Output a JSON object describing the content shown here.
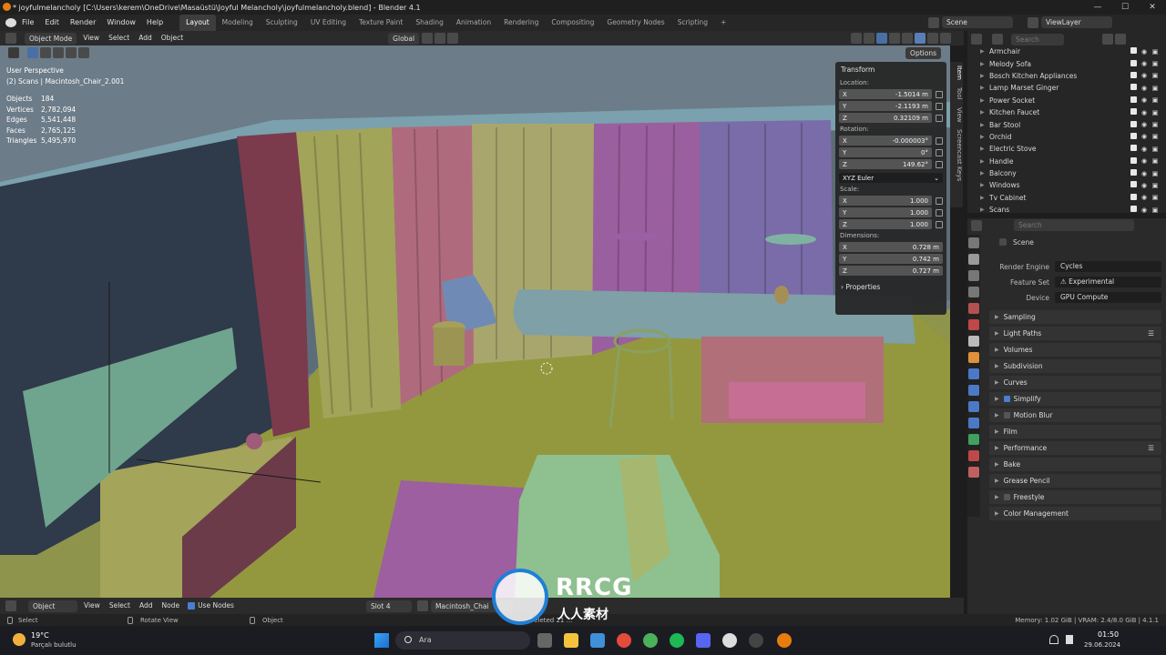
{
  "window": {
    "title": "* joyfulmelancholy [C:\\Users\\kerem\\OneDrive\\Masaüstü\\Joyful Melancholy\\joyfulmelancholy.blend] - Blender 4.1",
    "buttons": [
      "—",
      "☐",
      "✕"
    ]
  },
  "menu": [
    "File",
    "Edit",
    "Render",
    "Window",
    "Help"
  ],
  "workspaces": [
    "Layout",
    "Modeling",
    "Sculpting",
    "UV Editing",
    "Texture Paint",
    "Shading",
    "Animation",
    "Rendering",
    "Compositing",
    "Geometry Nodes",
    "Scripting"
  ],
  "active_workspace": "Layout",
  "scene_selector": "Scene",
  "view_layer": "ViewLayer",
  "viewport_header": {
    "mode": "Object Mode",
    "menus": [
      "View",
      "Select",
      "Add",
      "Object"
    ],
    "orientation": "Global",
    "options": "Options"
  },
  "overlay": {
    "view_name": "User Perspective",
    "collection": "(2) Scans | Macintosh_Chair_2.001",
    "stats": [
      {
        "label": "Objects",
        "value": "184"
      },
      {
        "label": "Vertices",
        "value": "2,782,094"
      },
      {
        "label": "Edges",
        "value": "5,541,448"
      },
      {
        "label": "Faces",
        "value": "2,765,125"
      },
      {
        "label": "Triangles",
        "value": "5,495,970"
      }
    ]
  },
  "npanel": {
    "header": "Transform",
    "location_label": "Location:",
    "location": [
      {
        "axis": "X",
        "value": "-1.5014 m"
      },
      {
        "axis": "Y",
        "value": "-2.1193 m"
      },
      {
        "axis": "Z",
        "value": "0.32109 m"
      }
    ],
    "rotation_label": "Rotation:",
    "rotation": [
      {
        "axis": "X",
        "value": "-0.000003°"
      },
      {
        "axis": "Y",
        "value": "0°"
      },
      {
        "axis": "Z",
        "value": "149.62°"
      }
    ],
    "rotation_mode": "XYZ Euler",
    "scale_label": "Scale:",
    "scale": [
      {
        "axis": "X",
        "value": "1.000"
      },
      {
        "axis": "Y",
        "value": "1.000"
      },
      {
        "axis": "Z",
        "value": "1.000"
      }
    ],
    "dimensions_label": "Dimensions:",
    "dimensions": [
      {
        "axis": "X",
        "value": "0.728 m"
      },
      {
        "axis": "Y",
        "value": "0.742 m"
      },
      {
        "axis": "Z",
        "value": "0.727 m"
      }
    ],
    "properties": "Properties",
    "tabs": [
      "Item",
      "Tool",
      "View",
      "Screencast Keys"
    ]
  },
  "outliner": {
    "search_placeholder": "Search",
    "items": [
      "Armchair",
      "Melody Sofa",
      "Bosch Kitchen Appliances",
      "Lamp Marset Ginger",
      "Power Socket",
      "Kitchen Faucet",
      "Bar Stool",
      "Orchid",
      "Electric Stove",
      "Handle",
      "Balcony",
      "Windows",
      "Tv Cabinet",
      "Scans"
    ]
  },
  "properties": {
    "search_placeholder": "Search",
    "context": "Scene",
    "render_engine_label": "Render Engine",
    "render_engine": "Cycles",
    "feature_set_label": "Feature Set",
    "feature_set": "Experimental",
    "device_label": "Device",
    "device": "GPU Compute",
    "panels": [
      "Sampling",
      "Light Paths",
      "Volumes",
      "Subdivision",
      "Curves",
      "Simplify",
      "Motion Blur",
      "Film",
      "Performance",
      "Bake",
      "Grease Pencil",
      "Freestyle",
      "Color Management"
    ]
  },
  "timeline": {
    "mode": "Object",
    "menus": [
      "View",
      "Select",
      "Add",
      "Node"
    ],
    "use_nodes": "Use Nodes",
    "slot": "Slot 4",
    "material": "Macintosh_Chai"
  },
  "statusbar": {
    "left": [
      "Select",
      "Rotate View",
      "Object"
    ],
    "toast": "Deleted 21 ...",
    "memory": "Memory: 1.02 GiB | VRAM: 2.4/8.0 GiB | 4.1.1"
  },
  "taskbar": {
    "weather_temp": "19°C",
    "weather_desc": "Parçalı bulutlu",
    "search": "Ara",
    "time": "01:50",
    "date": "29.06.2024"
  },
  "watermark": {
    "brand": "RRCG",
    "sub": "人人素材"
  }
}
